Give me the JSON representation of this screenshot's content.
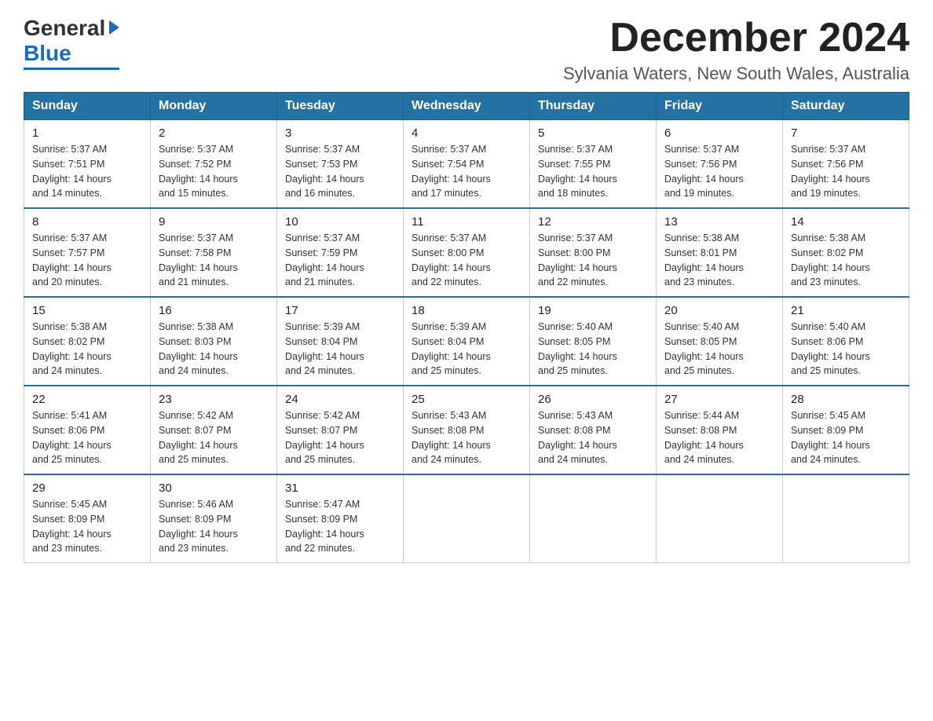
{
  "header": {
    "logo_general": "General",
    "logo_blue": "Blue",
    "month_title": "December 2024",
    "location": "Sylvania Waters, New South Wales, Australia"
  },
  "days_of_week": [
    "Sunday",
    "Monday",
    "Tuesday",
    "Wednesday",
    "Thursday",
    "Friday",
    "Saturday"
  ],
  "weeks": [
    [
      {
        "day": "1",
        "sunrise": "5:37 AM",
        "sunset": "7:51 PM",
        "daylight": "14 hours and 14 minutes."
      },
      {
        "day": "2",
        "sunrise": "5:37 AM",
        "sunset": "7:52 PM",
        "daylight": "14 hours and 15 minutes."
      },
      {
        "day": "3",
        "sunrise": "5:37 AM",
        "sunset": "7:53 PM",
        "daylight": "14 hours and 16 minutes."
      },
      {
        "day": "4",
        "sunrise": "5:37 AM",
        "sunset": "7:54 PM",
        "daylight": "14 hours and 17 minutes."
      },
      {
        "day": "5",
        "sunrise": "5:37 AM",
        "sunset": "7:55 PM",
        "daylight": "14 hours and 18 minutes."
      },
      {
        "day": "6",
        "sunrise": "5:37 AM",
        "sunset": "7:56 PM",
        "daylight": "14 hours and 19 minutes."
      },
      {
        "day": "7",
        "sunrise": "5:37 AM",
        "sunset": "7:56 PM",
        "daylight": "14 hours and 19 minutes."
      }
    ],
    [
      {
        "day": "8",
        "sunrise": "5:37 AM",
        "sunset": "7:57 PM",
        "daylight": "14 hours and 20 minutes."
      },
      {
        "day": "9",
        "sunrise": "5:37 AM",
        "sunset": "7:58 PM",
        "daylight": "14 hours and 21 minutes."
      },
      {
        "day": "10",
        "sunrise": "5:37 AM",
        "sunset": "7:59 PM",
        "daylight": "14 hours and 21 minutes."
      },
      {
        "day": "11",
        "sunrise": "5:37 AM",
        "sunset": "8:00 PM",
        "daylight": "14 hours and 22 minutes."
      },
      {
        "day": "12",
        "sunrise": "5:37 AM",
        "sunset": "8:00 PM",
        "daylight": "14 hours and 22 minutes."
      },
      {
        "day": "13",
        "sunrise": "5:38 AM",
        "sunset": "8:01 PM",
        "daylight": "14 hours and 23 minutes."
      },
      {
        "day": "14",
        "sunrise": "5:38 AM",
        "sunset": "8:02 PM",
        "daylight": "14 hours and 23 minutes."
      }
    ],
    [
      {
        "day": "15",
        "sunrise": "5:38 AM",
        "sunset": "8:02 PM",
        "daylight": "14 hours and 24 minutes."
      },
      {
        "day": "16",
        "sunrise": "5:38 AM",
        "sunset": "8:03 PM",
        "daylight": "14 hours and 24 minutes."
      },
      {
        "day": "17",
        "sunrise": "5:39 AM",
        "sunset": "8:04 PM",
        "daylight": "14 hours and 24 minutes."
      },
      {
        "day": "18",
        "sunrise": "5:39 AM",
        "sunset": "8:04 PM",
        "daylight": "14 hours and 25 minutes."
      },
      {
        "day": "19",
        "sunrise": "5:40 AM",
        "sunset": "8:05 PM",
        "daylight": "14 hours and 25 minutes."
      },
      {
        "day": "20",
        "sunrise": "5:40 AM",
        "sunset": "8:05 PM",
        "daylight": "14 hours and 25 minutes."
      },
      {
        "day": "21",
        "sunrise": "5:40 AM",
        "sunset": "8:06 PM",
        "daylight": "14 hours and 25 minutes."
      }
    ],
    [
      {
        "day": "22",
        "sunrise": "5:41 AM",
        "sunset": "8:06 PM",
        "daylight": "14 hours and 25 minutes."
      },
      {
        "day": "23",
        "sunrise": "5:42 AM",
        "sunset": "8:07 PM",
        "daylight": "14 hours and 25 minutes."
      },
      {
        "day": "24",
        "sunrise": "5:42 AM",
        "sunset": "8:07 PM",
        "daylight": "14 hours and 25 minutes."
      },
      {
        "day": "25",
        "sunrise": "5:43 AM",
        "sunset": "8:08 PM",
        "daylight": "14 hours and 24 minutes."
      },
      {
        "day": "26",
        "sunrise": "5:43 AM",
        "sunset": "8:08 PM",
        "daylight": "14 hours and 24 minutes."
      },
      {
        "day": "27",
        "sunrise": "5:44 AM",
        "sunset": "8:08 PM",
        "daylight": "14 hours and 24 minutes."
      },
      {
        "day": "28",
        "sunrise": "5:45 AM",
        "sunset": "8:09 PM",
        "daylight": "14 hours and 24 minutes."
      }
    ],
    [
      {
        "day": "29",
        "sunrise": "5:45 AM",
        "sunset": "8:09 PM",
        "daylight": "14 hours and 23 minutes."
      },
      {
        "day": "30",
        "sunrise": "5:46 AM",
        "sunset": "8:09 PM",
        "daylight": "14 hours and 23 minutes."
      },
      {
        "day": "31",
        "sunrise": "5:47 AM",
        "sunset": "8:09 PM",
        "daylight": "14 hours and 22 minutes."
      },
      null,
      null,
      null,
      null
    ]
  ],
  "labels": {
    "sunrise": "Sunrise:",
    "sunset": "Sunset:",
    "daylight": "Daylight:"
  }
}
